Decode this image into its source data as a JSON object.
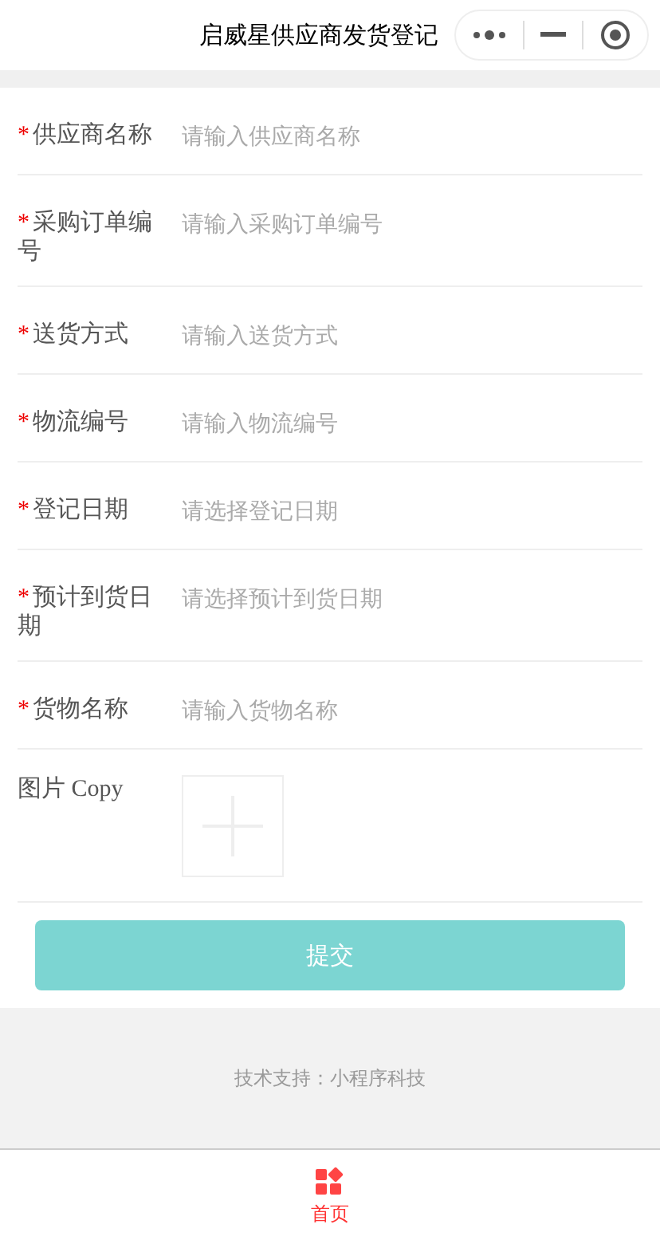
{
  "nav_bar": {
    "title": "启威星供应商发货登记"
  },
  "form": {
    "fields": [
      {
        "kind": "text",
        "label": "供应商名称",
        "required": true,
        "placeholder": "请输入供应商名称"
      },
      {
        "kind": "text",
        "label": "采购订单编号",
        "required": true,
        "placeholder": "请输入采购订单编号"
      },
      {
        "kind": "text",
        "label": "送货方式",
        "required": true,
        "placeholder": "请输入送货方式"
      },
      {
        "kind": "text",
        "label": "物流编号",
        "required": true,
        "placeholder": "请输入物流编号"
      },
      {
        "kind": "date",
        "label": "登记日期",
        "required": true,
        "placeholder": "请选择登记日期"
      },
      {
        "kind": "date",
        "label": "预计到货日期",
        "required": true,
        "placeholder": "请选择预计到货日期"
      },
      {
        "kind": "text",
        "label": "货物名称",
        "required": true,
        "placeholder": "请输入货物名称"
      },
      {
        "kind": "image",
        "label": "图片 Copy",
        "required": false
      }
    ],
    "required_mark": "*",
    "submit": "提交"
  },
  "footer": {
    "text": "技术支持：小程序科技"
  },
  "tab_bar": [
    {
      "label": "首页",
      "selected": true
    }
  ]
}
